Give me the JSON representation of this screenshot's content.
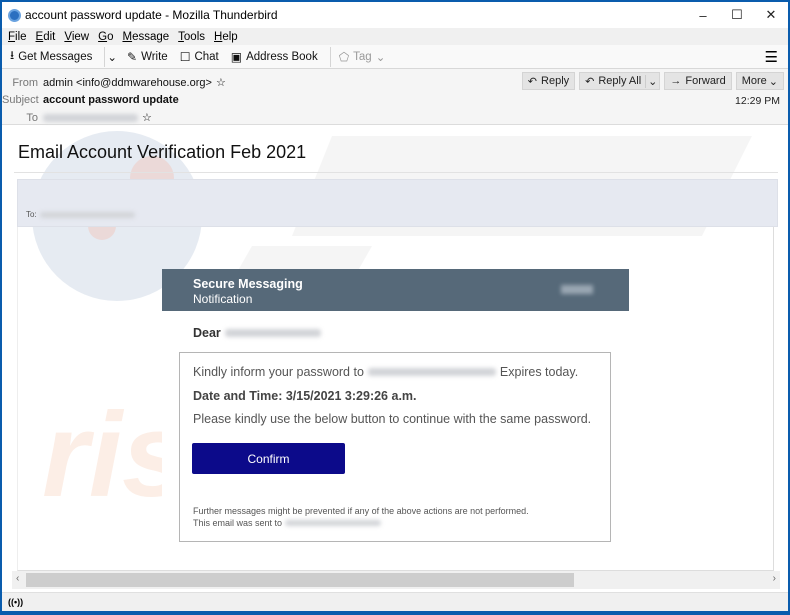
{
  "window": {
    "title": "account password update - Mozilla Thunderbird",
    "controls": {
      "minimize": "–",
      "maximize": "☐",
      "close": "✕"
    }
  },
  "menubar": {
    "items": [
      {
        "label": "File",
        "accel": "F",
        "rest": "ile"
      },
      {
        "label": "Edit",
        "accel": "E",
        "rest": "dit"
      },
      {
        "label": "View",
        "accel": "V",
        "rest": "iew"
      },
      {
        "label": "Go",
        "accel": "G",
        "rest": "o"
      },
      {
        "label": "Message",
        "accel": "M",
        "rest": "essage"
      },
      {
        "label": "Tools",
        "accel": "T",
        "rest": "ools"
      },
      {
        "label": "Help",
        "accel": "H",
        "rest": "elp"
      }
    ]
  },
  "toolbar": {
    "get_messages": "Get Messages",
    "write": "Write",
    "chat": "Chat",
    "address_book": "Address Book",
    "tag": "Tag",
    "icons": {
      "get_messages": "⭳",
      "write": "✎",
      "chat": "☐",
      "address_book": "▣",
      "tag": "⬠",
      "dropdown": "⌄",
      "menu": "☰"
    }
  },
  "headers": {
    "from_label": "From",
    "from_value": "admin <info@ddmwarehouse.org>",
    "subject_label": "Subject",
    "subject_value": "account password update",
    "to_label": "To",
    "star": "☆",
    "time": "12:29 PM",
    "actions": {
      "reply": "Reply",
      "reply_all": "Reply All",
      "forward": "Forward",
      "more": "More"
    },
    "action_icons": {
      "reply": "↶",
      "reply_all": "↶",
      "forward": "→",
      "dropdown": "⌄"
    }
  },
  "message": {
    "title": "Email Account Verification Feb 2021",
    "to_label": "To:",
    "card": {
      "header_title": "Secure Messaging",
      "header_subtitle": "Notification",
      "greeting": "Dear",
      "line1_prefix": "Kindly inform your password to",
      "line1_suffix": "Expires today.",
      "date_time": "Date and Time: 3/15/2021 3:29:26 a.m.",
      "line3": "Please kindly use the below button to continue with the same password.",
      "confirm_label": "Confirm",
      "footer1": "Further messages might be prevented if any of the above actions are not performed.",
      "footer2": "This email was sent to"
    }
  },
  "scrollbar": {
    "left_arrow": "‹",
    "right_arrow": "›",
    "position_fraction": 0.74
  },
  "statusbar": {
    "icon": "((•))"
  },
  "colors": {
    "card_header": "#566979",
    "confirm_button": "#0c0a8a",
    "to_band": "#e6e9f1",
    "window_frame": "#0a5cad"
  }
}
